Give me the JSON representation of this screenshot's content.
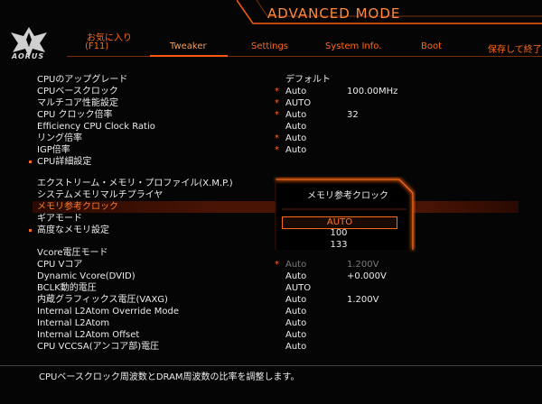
{
  "header": {
    "logo_text": "AORUS",
    "mode_title": "ADVANCED MODE",
    "favorites_label": "お気に入り",
    "favorites_key": "(F11)",
    "tabs": [
      {
        "label": "Tweaker"
      },
      {
        "label": "Settings"
      },
      {
        "label": "System Info."
      },
      {
        "label": "Boot"
      },
      {
        "label": "保存して終了"
      }
    ]
  },
  "rows": [
    {
      "label": "CPUのアップグレード",
      "value": "デフォルト",
      "value2": "",
      "star": ""
    },
    {
      "label": "CPUベースクロック",
      "value": "Auto",
      "value2": "100.00MHz",
      "star": "*"
    },
    {
      "label": "マルチコア性能設定",
      "value": "AUTO",
      "value2": "",
      "star": "*"
    },
    {
      "label": "CPU クロック倍率",
      "value": "Auto",
      "value2": "32",
      "star": "*"
    },
    {
      "label": "Efficiency CPU Clock Ratio",
      "value": "Auto",
      "value2": "",
      "star": ""
    },
    {
      "label": "リング倍率",
      "value": "Auto",
      "value2": "",
      "star": "*"
    },
    {
      "label": "IGP倍率",
      "value": "Auto",
      "value2": "",
      "star": "*"
    },
    {
      "label": "CPU詳細設定",
      "value": "",
      "value2": "",
      "star": ""
    },
    {
      "label": "エクストリーム・メモリ・プロファイル(X.M.P.)",
      "value": "",
      "value2": "",
      "star": ""
    },
    {
      "label": "システムメモリマルチプライヤ",
      "value": "",
      "value2": "",
      "star": ""
    },
    {
      "label": "メモリ参考クロック",
      "value": "",
      "value2": "",
      "star": ""
    },
    {
      "label": "ギアモード",
      "value": "",
      "value2": "",
      "star": ""
    },
    {
      "label": "高度なメモリ設定",
      "value": "",
      "value2": "",
      "star": ""
    },
    {
      "label": "Vcore電圧モード",
      "value": "",
      "value2": "",
      "star": ""
    },
    {
      "label": "CPU Vコア",
      "value": "Auto",
      "value2": "1.200V",
      "star": "*"
    },
    {
      "label": "Dynamic Vcore(DVID)",
      "value": "Auto",
      "value2": "+0.000V",
      "star": ""
    },
    {
      "label": "BCLK動的電圧",
      "value": "AUTO",
      "value2": "",
      "star": ""
    },
    {
      "label": "内蔵グラフィックス電圧(VAXG)",
      "value": "Auto",
      "value2": "1.200V",
      "star": ""
    },
    {
      "label": "Internal L2Atom Override Mode",
      "value": "Auto",
      "value2": "",
      "star": ""
    },
    {
      "label": "Internal L2Atom",
      "value": "Auto",
      "value2": "",
      "star": ""
    },
    {
      "label": "Internal L2Atom Offset",
      "value": "Auto",
      "value2": "",
      "star": ""
    },
    {
      "label": "CPU VCCSA(アンコア部)電圧",
      "value": "Auto",
      "value2": "",
      "star": ""
    }
  ],
  "popup": {
    "title": "メモリ参考クロック",
    "options": [
      "AUTO",
      "100",
      "133"
    ],
    "selected": "AUTO"
  },
  "help_text": "CPUベースクロック周波数とDRAM周波数の比率を調整します。",
  "colors": {
    "accent": "#ff6a1a",
    "text": "#ececec",
    "background": "#050505"
  }
}
